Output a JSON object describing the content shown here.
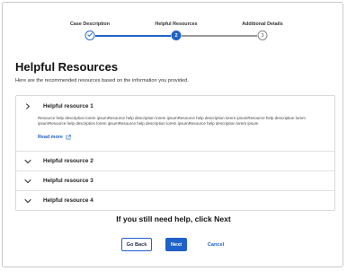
{
  "stepper": {
    "steps": [
      {
        "label": "Case Description",
        "number": "1",
        "state": "done"
      },
      {
        "label": "Helpful Resources",
        "number": "2",
        "state": "active"
      },
      {
        "label": "Additional Details",
        "number": "3",
        "state": "todo"
      }
    ]
  },
  "page": {
    "title": "Helpful Resources",
    "intro": "Here are the recommended resources based on the information you provided."
  },
  "resources": [
    {
      "title": "Helpful resource 1",
      "expanded": true,
      "description": "Resource help description lorem ipsumResource help description lorem ipsumResource help description lorem ipsumResource help description lorem ipsumResource help description lorem ipsumResource help description lorem ipsumResource help description lorem ipsum",
      "read_more": "Read more"
    },
    {
      "title": "Helpful resource 2",
      "expanded": false
    },
    {
      "title": "Helpful resource 3",
      "expanded": false
    },
    {
      "title": "Helpful resource 4",
      "expanded": false
    }
  ],
  "help_text": "If you still need help, click Next",
  "actions": {
    "back": "Go Back",
    "next": "Next",
    "cancel": "Cancel"
  },
  "colors": {
    "primary": "#1f62c9",
    "line_done": "#1f62c9",
    "line_todo": "#9a9a9a"
  }
}
